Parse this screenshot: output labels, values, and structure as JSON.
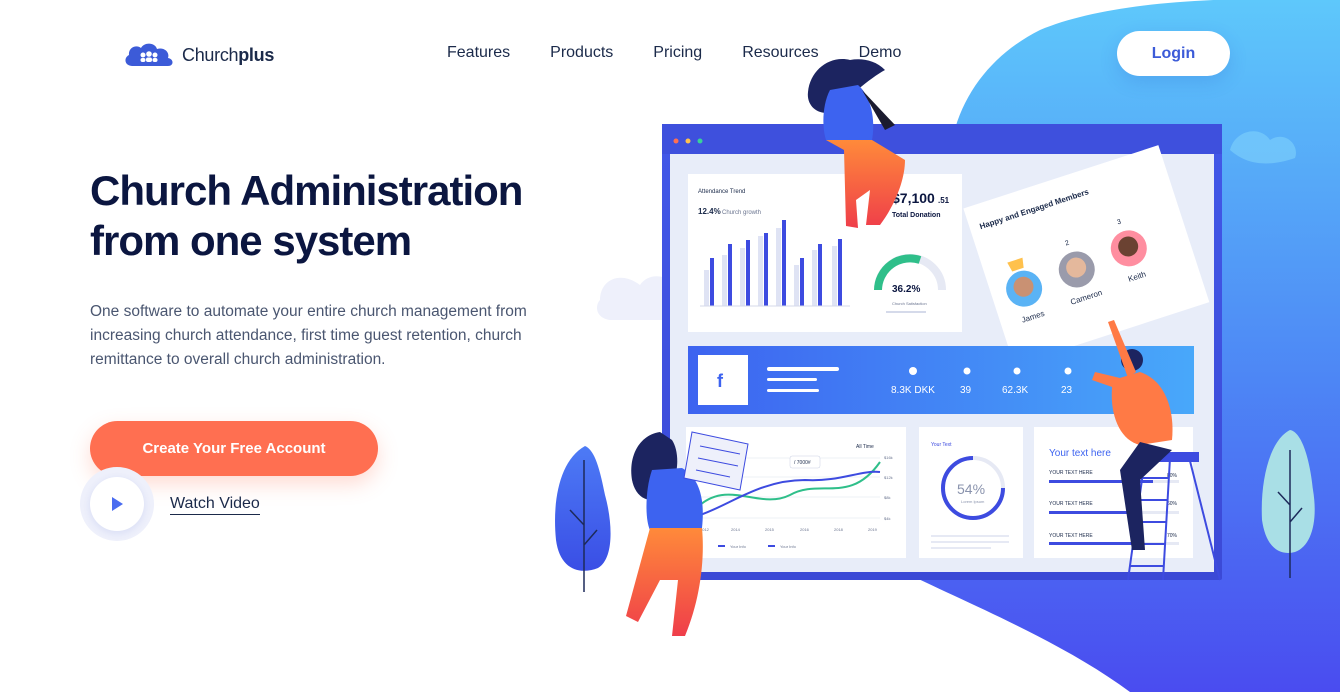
{
  "brand": {
    "name_regular": "Church",
    "name_bold": "plus"
  },
  "nav": {
    "items": [
      "Features",
      "Products",
      "Pricing",
      "Resources",
      "Demo"
    ],
    "login_label": "Login"
  },
  "hero": {
    "title_line1": "Church Administration",
    "title_line2": "from one system",
    "description": "One software to automate your entire church management from increasing church attendance, first time guest retention, church remittance to overall church administration.",
    "cta_label": "Create Your Free Account",
    "watch_label": "Watch Video"
  },
  "dashboard": {
    "attendance_title": "Attendance Trend",
    "growth_pct": "12.4%",
    "growth_label": "Church growth",
    "donation_amount": "$7,100",
    "donation_cents": ".51",
    "donation_label": "Total Donation",
    "gauge_value": "36.2%",
    "gauge_label": "Church Satisfaction",
    "members_title": "Happy and Engaged Members",
    "members": [
      {
        "rank": "",
        "name": "James"
      },
      {
        "rank": "2",
        "name": "Cameron"
      },
      {
        "rank": "3",
        "name": "Keith"
      }
    ],
    "social_stats": [
      "8.3K DKK",
      "39",
      "62.3K",
      "23"
    ],
    "line_chart_filter": "All Time",
    "line_chart_tooltip": "/ 7000#",
    "line_chart_years": [
      "2012",
      "2014",
      "2015",
      "2016",
      "2018",
      "2019"
    ],
    "line_chart_yticks": [
      "$16k",
      "$12k",
      "$8k",
      "$4k"
    ],
    "legend": [
      "Your Info",
      "Your Info"
    ],
    "donut_title": "Your Text",
    "donut_value": "54%",
    "donut_sub": "Lorem Ipsum",
    "bars_title": "Your text here",
    "bars": [
      {
        "label": "YOUR TEXT HERE",
        "value": "80%"
      },
      {
        "label": "YOUR TEXT HERE",
        "value": "60%"
      },
      {
        "label": "YOUR TEXT HERE",
        "value": "70%"
      }
    ]
  },
  "colors": {
    "accent": "#ff6f51",
    "brand_blue": "#3c5bd8",
    "dark_text": "#0b1640",
    "blob_blue": "#4a7bf7"
  }
}
